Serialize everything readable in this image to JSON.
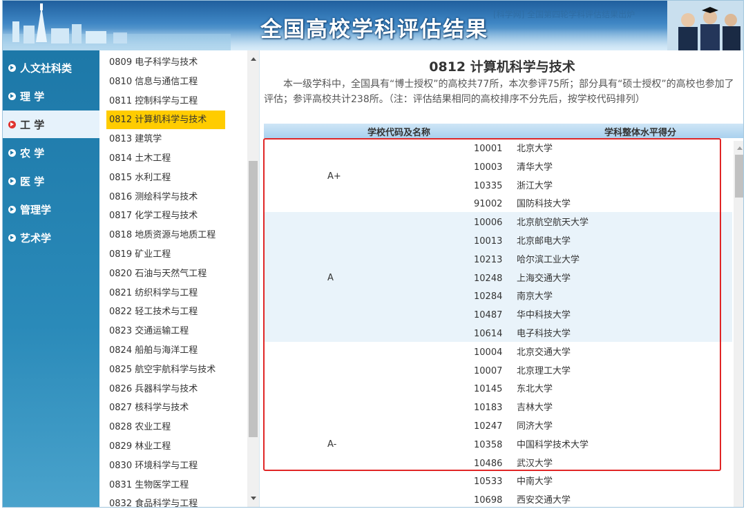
{
  "banner": {
    "title": "全国高校学科评估结果",
    "marquee": "[科学网] 全国第四轮学科评估结果出炉"
  },
  "categories": [
    {
      "label": "人文社科类",
      "active": false
    },
    {
      "label": "理 学",
      "active": false
    },
    {
      "label": "工 学",
      "active": true
    },
    {
      "label": "农 学",
      "active": false
    },
    {
      "label": "医 学",
      "active": false
    },
    {
      "label": "管理学",
      "active": false
    },
    {
      "label": "艺术学",
      "active": false
    }
  ],
  "subjects": [
    "0809 电子科学与技术",
    "0810 信息与通信工程",
    "0811 控制科学与工程",
    "0812 计算机科学与技术",
    "0813 建筑学",
    "0814 土木工程",
    "0815 水利工程",
    "0816 测绘科学与技术",
    "0817 化学工程与技术",
    "0818 地质资源与地质工程",
    "0819 矿业工程",
    "0820 石油与天然气工程",
    "0821 纺织科学与工程",
    "0822 轻工技术与工程",
    "0823 交通运输工程",
    "0824 船舶与海洋工程",
    "0825 航空宇航科学与技术",
    "0826 兵器科学与技术",
    "0827 核科学与技术",
    "0828 农业工程",
    "0829 林业工程",
    "0830 环境科学与工程",
    "0831 生物医学工程",
    "0832 食品科学与工程"
  ],
  "selected_subject_index": 3,
  "main": {
    "title": "0812 计算机科学与技术",
    "intro": "本一级学科中，全国具有“博士授权”的高校共77所，本次参评75所；部分具有“硕士授权”的高校也参加了评估；参评高校共计238所。（注：评估结果相同的高校排序不分先后，按学校代码排列）",
    "col_school": "学校代码及名称",
    "col_score": "学科整体水平得分"
  },
  "grades": [
    {
      "grade": "A+",
      "shaded": false,
      "schools": [
        {
          "code": "10001",
          "name": "北京大学"
        },
        {
          "code": "10003",
          "name": "清华大学"
        },
        {
          "code": "10335",
          "name": "浙江大学"
        },
        {
          "code": "91002",
          "name": "国防科技大学"
        }
      ]
    },
    {
      "grade": "A",
      "shaded": true,
      "schools": [
        {
          "code": "10006",
          "name": "北京航空航天大学"
        },
        {
          "code": "10013",
          "name": "北京邮电大学"
        },
        {
          "code": "10213",
          "name": "哈尔滨工业大学"
        },
        {
          "code": "10248",
          "name": "上海交通大学"
        },
        {
          "code": "10284",
          "name": "南京大学"
        },
        {
          "code": "10487",
          "name": "华中科技大学"
        },
        {
          "code": "10614",
          "name": "电子科技大学"
        }
      ]
    },
    {
      "grade": "A-",
      "shaded": false,
      "schools": [
        {
          "code": "10004",
          "name": "北京交通大学"
        },
        {
          "code": "10007",
          "name": "北京理工大学"
        },
        {
          "code": "10145",
          "name": "东北大学"
        },
        {
          "code": "10183",
          "name": "吉林大学"
        },
        {
          "code": "10247",
          "name": "同济大学"
        },
        {
          "code": "10358",
          "name": "中国科学技术大学"
        },
        {
          "code": "10486",
          "name": "武汉大学"
        },
        {
          "code": "10533",
          "name": "中南大学"
        },
        {
          "code": "10698",
          "name": "西安交通大学"
        }
      ]
    }
  ],
  "colors": {
    "nav_bg": "#1d78a8",
    "selected_subject": "#ffcc00",
    "active_bullet": "#e0332f",
    "highlight_box": "#e02525",
    "shaded_row": "#e9f3fa"
  }
}
